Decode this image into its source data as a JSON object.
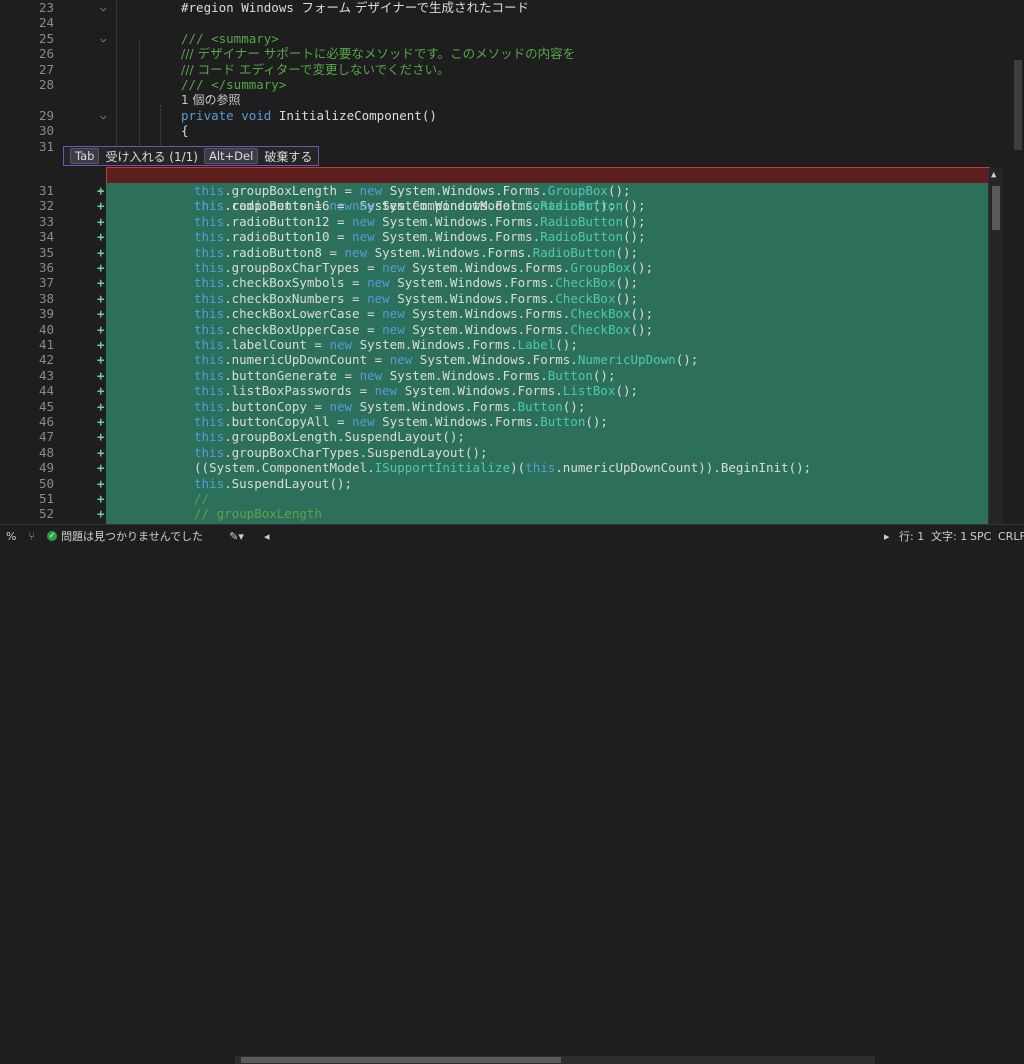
{
  "header_lines": [
    {
      "num": "23",
      "fold": "⌵",
      "parts": [
        {
          "t": "#region Windows ",
          "c": "plain"
        },
        {
          "t": "フォーム デザイナーで生成されたコード",
          "c": "plain jp"
        }
      ]
    },
    {
      "num": "24",
      "fold": "",
      "parts": []
    },
    {
      "num": "25",
      "fold": "⌵",
      "parts": [
        {
          "t": "/// <summary>",
          "c": "cm"
        }
      ]
    },
    {
      "num": "26",
      "fold": "",
      "parts": [
        {
          "t": "/// デザイナー サポートに必要なメソッドです。このメソッドの内容を",
          "c": "cm jp"
        }
      ]
    },
    {
      "num": "27",
      "fold": "",
      "parts": [
        {
          "t": "/// コード エディターで変更しないでください。",
          "c": "cm jp"
        }
      ]
    },
    {
      "num": "28",
      "fold": "",
      "parts": [
        {
          "t": "/// </summary>",
          "c": "cm"
        }
      ]
    },
    {
      "num": "",
      "fold": "",
      "parts": [
        {
          "t": "1 個の参照",
          "c": "ref"
        }
      ]
    },
    {
      "num": "29",
      "fold": "⌵",
      "parts": [
        {
          "t": "private void ",
          "c": "kw"
        },
        {
          "t": "InitializeComponent()",
          "c": "plain"
        }
      ]
    },
    {
      "num": "30",
      "fold": "",
      "parts": [
        {
          "t": "{",
          "c": "plain"
        }
      ]
    },
    {
      "num": "31",
      "fold": "",
      "parts": []
    }
  ],
  "hint": {
    "tab_key": "Tab",
    "accept": "受け入れる (1/1)",
    "alt_key": "Alt+Del",
    "discard": "破棄する"
  },
  "removed_line": {
    "sign": "-",
    "text": "this.components = new System.ComponentModel.Container();"
  },
  "added_lines": [
    {
      "num": "31",
      "text": "this.groupBoxLength = new System.Windows.Forms.GroupBox();"
    },
    {
      "num": "32",
      "text": "this.radioButton16 = new System.Windows.Forms.RadioButton();"
    },
    {
      "num": "33",
      "text": "this.radioButton12 = new System.Windows.Forms.RadioButton();"
    },
    {
      "num": "34",
      "text": "this.radioButton10 = new System.Windows.Forms.RadioButton();"
    },
    {
      "num": "35",
      "text": "this.radioButton8 = new System.Windows.Forms.RadioButton();"
    },
    {
      "num": "36",
      "text": "this.groupBoxCharTypes = new System.Windows.Forms.GroupBox();"
    },
    {
      "num": "37",
      "text": "this.checkBoxSymbols = new System.Windows.Forms.CheckBox();"
    },
    {
      "num": "38",
      "text": "this.checkBoxNumbers = new System.Windows.Forms.CheckBox();"
    },
    {
      "num": "39",
      "text": "this.checkBoxLowerCase = new System.Windows.Forms.CheckBox();"
    },
    {
      "num": "40",
      "text": "this.checkBoxUpperCase = new System.Windows.Forms.CheckBox();"
    },
    {
      "num": "41",
      "text": "this.labelCount = new System.Windows.Forms.Label();"
    },
    {
      "num": "42",
      "text": "this.numericUpDownCount = new System.Windows.Forms.NumericUpDown();"
    },
    {
      "num": "43",
      "text": "this.buttonGenerate = new System.Windows.Forms.Button();"
    },
    {
      "num": "44",
      "text": "this.listBoxPasswords = new System.Windows.Forms.ListBox();"
    },
    {
      "num": "45",
      "text": "this.buttonCopy = new System.Windows.Forms.Button();"
    },
    {
      "num": "46",
      "text": "this.buttonCopyAll = new System.Windows.Forms.Button();"
    },
    {
      "num": "47",
      "text": "this.groupBoxLength.SuspendLayout();"
    },
    {
      "num": "48",
      "text": "this.groupBoxCharTypes.SuspendLayout();"
    },
    {
      "num": "49",
      "text": "((System.ComponentModel.ISupportInitialize)(this.numericUpDownCount)).BeginInit();"
    },
    {
      "num": "50",
      "text": "this.SuspendLayout();"
    },
    {
      "num": "51",
      "text": "//"
    },
    {
      "num": "52",
      "text": "// groupBoxLength"
    }
  ],
  "status": {
    "zoom": "%",
    "issues": "問題は見つかりませんでした",
    "line": "行: 1",
    "char": "文字: 1",
    "spc": "SPC",
    "crlf": "CRLF"
  },
  "colors": {
    "added_bg": "#2c6f5a",
    "removed_bg": "#5d1e1e",
    "hint_border": "#6c55b8"
  }
}
